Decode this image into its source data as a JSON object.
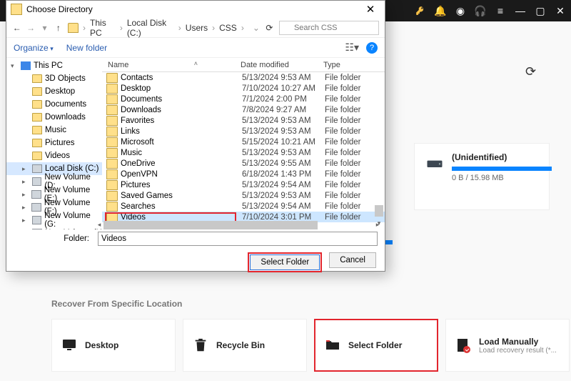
{
  "titlebar_icons": [
    "key",
    "bell",
    "disc",
    "headphones",
    "menu",
    "min",
    "max",
    "close"
  ],
  "dialog": {
    "title": "Choose Directory",
    "breadcrumbs": [
      "This PC",
      "Local Disk (C:)",
      "Users",
      "CSS"
    ],
    "search_placeholder": "Search CSS",
    "organize": "Organize",
    "newfolder": "New folder",
    "coln": "Name",
    "cold": "Date modified",
    "colt": "Type",
    "folder_label": "Folder:",
    "folder_value": "Videos",
    "select_btn": "Select Folder",
    "cancel_btn": "Cancel"
  },
  "tree": [
    {
      "label": "This PC",
      "kind": "pc",
      "indent": 0,
      "chev": "▾"
    },
    {
      "label": "3D Objects",
      "kind": "f",
      "indent": 1
    },
    {
      "label": "Desktop",
      "kind": "f",
      "indent": 1
    },
    {
      "label": "Documents",
      "kind": "f",
      "indent": 1
    },
    {
      "label": "Downloads",
      "kind": "f",
      "indent": 1
    },
    {
      "label": "Music",
      "kind": "f",
      "indent": 1
    },
    {
      "label": "Pictures",
      "kind": "f",
      "indent": 1
    },
    {
      "label": "Videos",
      "kind": "f",
      "indent": 1
    },
    {
      "label": "Local Disk (C:)",
      "kind": "d",
      "indent": 1,
      "sel": true,
      "chev": "▸"
    },
    {
      "label": "New Volume (D:",
      "kind": "d",
      "indent": 1,
      "chev": "▸"
    },
    {
      "label": "New Volume (E:)",
      "kind": "d",
      "indent": 1,
      "chev": "▸"
    },
    {
      "label": "New Volume (F:)",
      "kind": "d",
      "indent": 1,
      "chev": "▸"
    },
    {
      "label": "New Volume (G:",
      "kind": "d",
      "indent": 1,
      "chev": "▸"
    },
    {
      "label": "New Volume (H",
      "kind": "d",
      "indent": 1,
      "chev": "▸"
    }
  ],
  "rows": [
    {
      "n": "Contacts",
      "d": "5/13/2024 9:53 AM",
      "t": "File folder"
    },
    {
      "n": "Desktop",
      "d": "7/10/2024 10:27 AM",
      "t": "File folder"
    },
    {
      "n": "Documents",
      "d": "7/1/2024 2:00 PM",
      "t": "File folder"
    },
    {
      "n": "Downloads",
      "d": "7/8/2024 9:27 AM",
      "t": "File folder"
    },
    {
      "n": "Favorites",
      "d": "5/13/2024 9:53 AM",
      "t": "File folder"
    },
    {
      "n": "Links",
      "d": "5/13/2024 9:53 AM",
      "t": "File folder"
    },
    {
      "n": "Microsoft",
      "d": "5/15/2024 10:21 AM",
      "t": "File folder"
    },
    {
      "n": "Music",
      "d": "5/13/2024 9:53 AM",
      "t": "File folder"
    },
    {
      "n": "OneDrive",
      "d": "5/13/2024 9:55 AM",
      "t": "File folder"
    },
    {
      "n": "OpenVPN",
      "d": "6/18/2024 1:43 PM",
      "t": "File folder"
    },
    {
      "n": "Pictures",
      "d": "5/13/2024 9:54 AM",
      "t": "File folder"
    },
    {
      "n": "Saved Games",
      "d": "5/13/2024 9:53 AM",
      "t": "File folder"
    },
    {
      "n": "Searches",
      "d": "5/13/2024 9:54 AM",
      "t": "File folder"
    },
    {
      "n": "Videos",
      "d": "7/10/2024 3:01 PM",
      "t": "File folder",
      "sel": true
    }
  ],
  "drive": {
    "name": "(Unidentified)",
    "size": "0 B / 15.98 MB"
  },
  "sd_label": ")",
  "recover_label": "Recover From Specific Location",
  "cards": {
    "desktop": "Desktop",
    "recycle": "Recycle Bin",
    "select": "Select Folder",
    "load": "Load Manually",
    "load_sub": "Load recovery result (*..."
  }
}
